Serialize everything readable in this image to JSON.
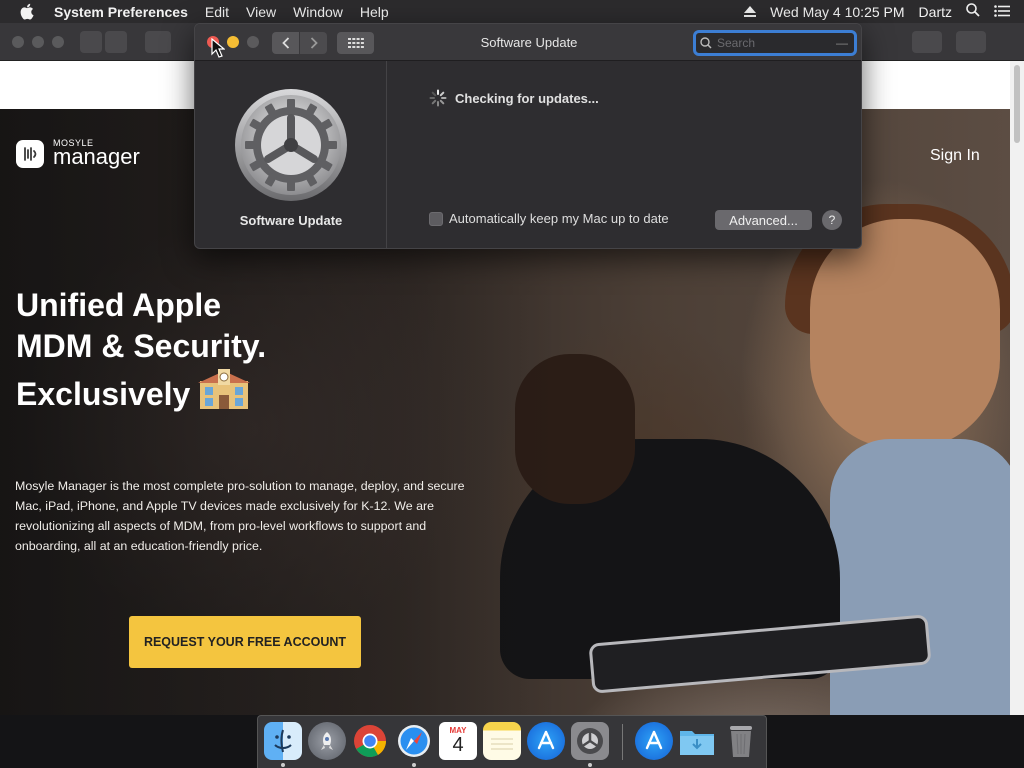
{
  "menubar": {
    "app_name": "System Preferences",
    "items": [
      "Edit",
      "View",
      "Window",
      "Help"
    ],
    "datetime": "Wed May 4  10:25 PM",
    "user": "Dartz"
  },
  "website": {
    "logo_small": "MOSYLE",
    "logo_big": "manager",
    "sign_in": "Sign In",
    "headline_line1": "Unified Apple",
    "headline_line2": "MDM & Security.",
    "headline_line3": "Exclusively",
    "paragraph": "Mosyle Manager is the most complete pro-solution to manage, deploy, and secure Mac, iPad, iPhone, and Apple TV devices made exclusively for K-12. We are revolutionizing all aspects of MDM, from pro-level workflows to support and onboarding, all at an education-friendly price.",
    "cta": "REQUEST YOUR FREE ACCOUNT"
  },
  "software_update": {
    "title": "Software Update",
    "search_placeholder": "Search",
    "pane_label": "Software Update",
    "status": "Checking for updates...",
    "auto_update_label": "Automatically keep my Mac up to date",
    "advanced_button": "Advanced...",
    "help_button": "?"
  },
  "dock": {
    "calendar_month": "MAY",
    "calendar_day": "4",
    "apps": [
      "finder-icon",
      "launchpad-icon",
      "chrome-icon",
      "safari-icon",
      "calendar-icon",
      "notes-icon",
      "app-store-icon",
      "system-preferences-icon",
      "app-store-icon",
      "downloads-folder-icon",
      "trash-icon"
    ]
  },
  "colors": {
    "accent": "#3c7ed4",
    "cta": "#f4c53f"
  }
}
